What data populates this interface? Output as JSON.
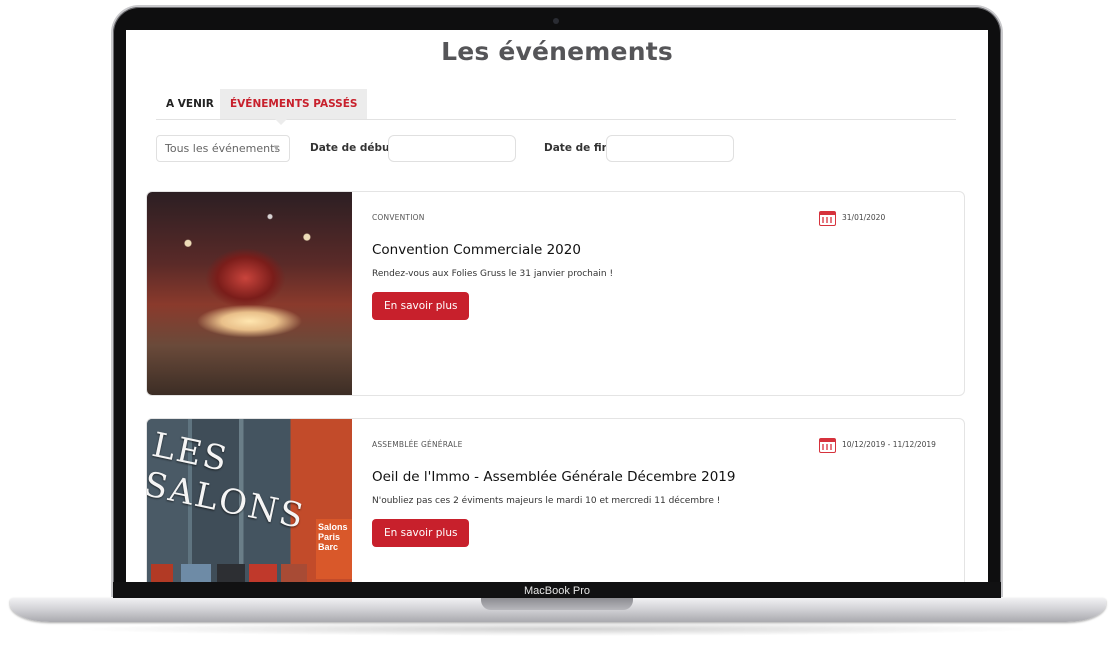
{
  "device": {
    "model_label": "MacBook Pro"
  },
  "page": {
    "title": "Les événements"
  },
  "tabs": [
    {
      "label": "A VENIR",
      "active": false
    },
    {
      "label": "ÉVÉNEMENTS PASSÉS",
      "active": true
    }
  ],
  "filters": {
    "type_select_value": "Tous les événements",
    "start_label": "Date de début",
    "start_value": "",
    "end_label": "Date de fin",
    "end_value": ""
  },
  "events": [
    {
      "category": "CONVENTION",
      "date": "31/01/2020",
      "title": "Convention Commerciale 2020",
      "description": "Rendez-vous aux Folies Gruss le 31 janvier prochain !",
      "button_label": "En savoir plus"
    },
    {
      "category": "ASSEMBLÉE GÉNÉRALE",
      "date": "10/12/2019 - 11/12/2019",
      "title": "Oeil de l'Immo - Assemblée Générale Décembre 2019",
      "description": "N'oubliez pas ces 2 éviments majeurs le mardi 10 et mercredi 11 décembre !",
      "button_label": "En savoir plus",
      "image_sign": "LES SALONS",
      "image_poster": "Salons Paris Barc"
    }
  ],
  "colors": {
    "accent": "#c8202c",
    "tab_bg": "#ececec",
    "border": "#e4e4e4"
  },
  "icons": {
    "date": "calendar-icon",
    "select": "chevron-down-icon"
  }
}
